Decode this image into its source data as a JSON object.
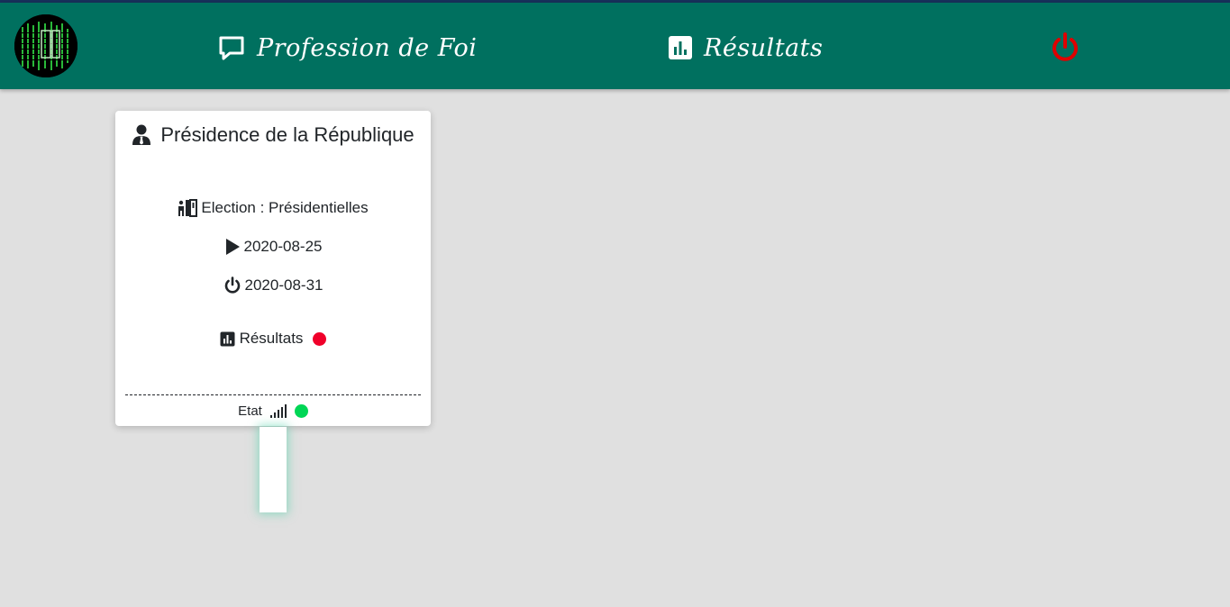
{
  "navbar": {
    "background": "#00705f",
    "logo_icon": "terminal-matrix-logo",
    "profession_label": "Profession de Foi",
    "profession_icon": "chat-bubble-icon",
    "resultats_label": "Résultats",
    "resultats_icon": "bar-chart-icon",
    "power_icon": "power-icon",
    "power_color": "#e00000"
  },
  "card": {
    "title": "Présidence de la République",
    "title_icon": "user-tie-icon",
    "election": "Election : Présidentielles",
    "election_icon": "ballot-box-icon",
    "start_date": "2020-08-25",
    "start_icon": "play-icon",
    "end_date": "2020-08-31",
    "end_icon": "power-icon",
    "results_label": "Résultats",
    "results_icon": "bar-chart-icon",
    "results_status_color": "#f0002a",
    "footer_label": "Etat",
    "footer_icon": "signal-icon",
    "footer_status_color": "#00d655"
  }
}
